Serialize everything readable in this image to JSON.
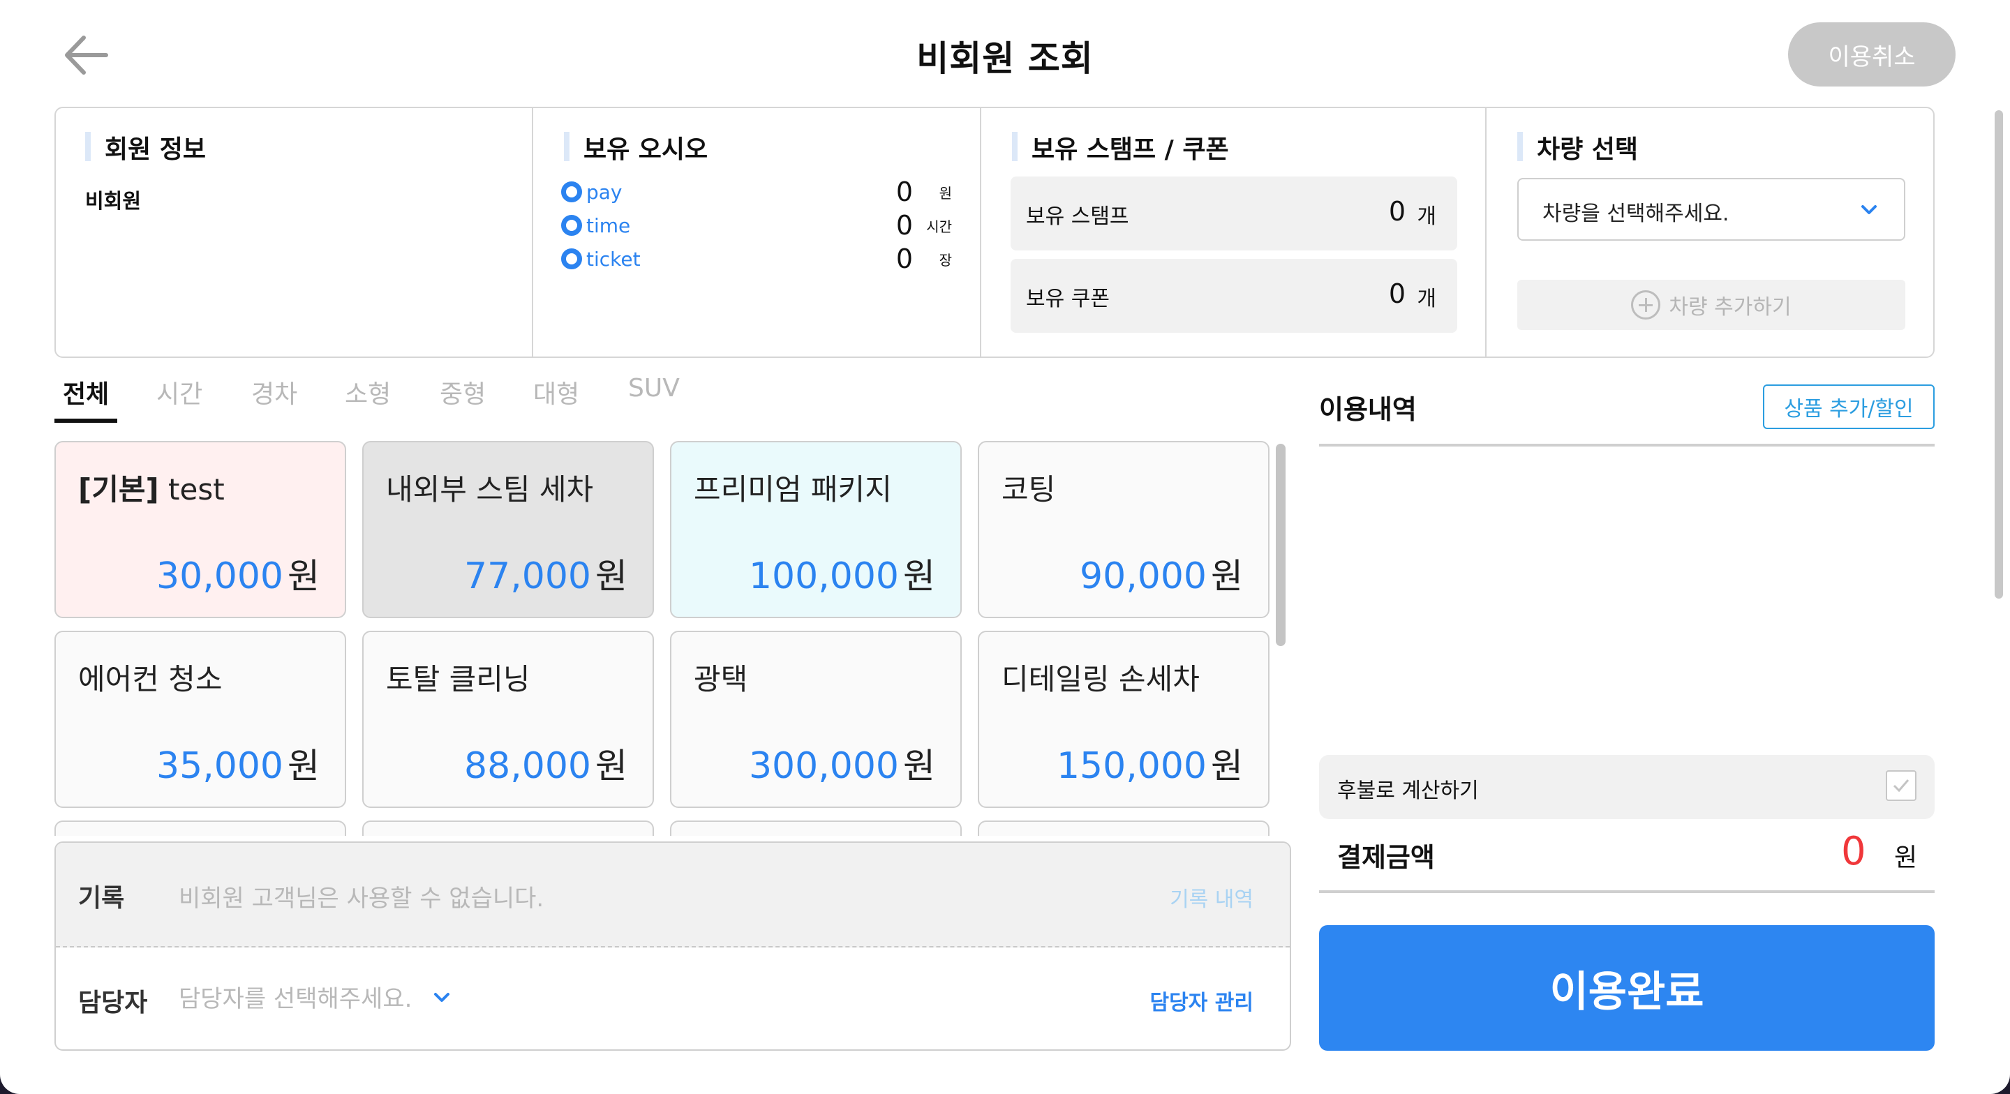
{
  "header": {
    "title": "비회원 조회",
    "cancel_label": "이용취소"
  },
  "member_info": {
    "title": "회원 정보",
    "type": "비회원"
  },
  "oasis": {
    "title": "보유 오시오",
    "items": [
      {
        "label": "pay",
        "value": "0",
        "unit": "원"
      },
      {
        "label": "time",
        "value": "0",
        "unit": "시간"
      },
      {
        "label": "ticket",
        "value": "0",
        "unit": "장"
      }
    ]
  },
  "stamp_coupon": {
    "title": "보유 스탬프 / 쿠폰",
    "stamp_label": "보유 스탬프",
    "stamp_value": "0",
    "stamp_unit": "개",
    "coupon_label": "보유 쿠폰",
    "coupon_value": "0",
    "coupon_unit": "개"
  },
  "vehicle": {
    "title": "차량 선택",
    "placeholder": "차량을 선택해주세요.",
    "add_label": "차량 추가하기"
  },
  "tabs": [
    {
      "label": "전체",
      "active": true
    },
    {
      "label": "시간",
      "active": false
    },
    {
      "label": "경차",
      "active": false
    },
    {
      "label": "소형",
      "active": false
    },
    {
      "label": "중형",
      "active": false
    },
    {
      "label": "대형",
      "active": false
    },
    {
      "label": "SUV",
      "active": false
    }
  ],
  "products": [
    {
      "name": "[기본] test",
      "name_prefix": "[기본]",
      "name_rest": " test",
      "price": "30,000",
      "unit": "원",
      "bg": "#fff0f0"
    },
    {
      "name": "내외부 스팀 세차",
      "name_prefix": "",
      "name_rest": "내외부 스팀 세차",
      "price": "77,000",
      "unit": "원",
      "bg": "#e4e4e4"
    },
    {
      "name": "프리미엄 패키지",
      "name_prefix": "",
      "name_rest": "프리미엄 패키지",
      "price": "100,000",
      "unit": "원",
      "bg": "#eafafc"
    },
    {
      "name": "코팅",
      "name_prefix": "",
      "name_rest": "코팅",
      "price": "90,000",
      "unit": "원",
      "bg": "#fafafa"
    },
    {
      "name": "에어컨 청소",
      "name_prefix": "",
      "name_rest": "에어컨 청소",
      "price": "35,000",
      "unit": "원",
      "bg": "#fafafa"
    },
    {
      "name": "토탈 클리닝",
      "name_prefix": "",
      "name_rest": "토탈 클리닝",
      "price": "88,000",
      "unit": "원",
      "bg": "#fafafa"
    },
    {
      "name": "광택",
      "name_prefix": "",
      "name_rest": "광택",
      "price": "300,000",
      "unit": "원",
      "bg": "#fafafa"
    },
    {
      "name": "디테일링 손세차",
      "name_prefix": "",
      "name_rest": "디테일링 손세차",
      "price": "150,000",
      "unit": "원",
      "bg": "#fafafa"
    }
  ],
  "record": {
    "label": "기록",
    "placeholder": "비회원 고객님은 사용할 수 없습니다.",
    "history_link": "기록 내역"
  },
  "manager": {
    "label": "담당자",
    "placeholder": "담당자를 선택해주세요.",
    "manage_link": "담당자 관리"
  },
  "usage": {
    "title": "이용내역",
    "add_button": "상품 추가/할인",
    "deferred_label": "후불로 계산하기",
    "total_label": "결제금액",
    "total_value": "0",
    "total_unit": "원",
    "complete_button": "이용완료"
  },
  "colors": {
    "accent": "#2d86f1",
    "price": "#2b83f0",
    "total": "#f0373a"
  }
}
